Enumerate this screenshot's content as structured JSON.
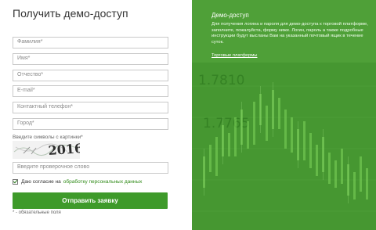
{
  "form": {
    "title": "Получить демо-доступ",
    "fields": [
      {
        "placeholder": "Фамилия*"
      },
      {
        "placeholder": "Имя*"
      },
      {
        "placeholder": "Отчество*"
      },
      {
        "placeholder": "E-mail*"
      },
      {
        "placeholder": "Контактный телефон*"
      },
      {
        "placeholder": "Город*"
      }
    ],
    "captcha_label": "Введите символы с картинки*",
    "captcha_text": "2016",
    "captcha_placeholder": "Введите проверочное слово",
    "agree_text": "Даю согласие на",
    "agree_link": "обработку персональных данных",
    "submit_label": "Отправить заявку",
    "required_note": "* - обязательные поля"
  },
  "info": {
    "title": "Демо-доступ",
    "text": "Для получения логина и пароля для демо-доступа к торговой платформе, заполните, пожалуйста, форму ниже. Логин, пароль а также подробные инструкции будут высланы Вам на указанный почтовый ящик в течение суток.",
    "link": "Торговые платформы",
    "chart_numbers": [
      "1.7810",
      "1.7765"
    ]
  },
  "colors": {
    "accent_green": "#3e9a2a",
    "panel_green": "#4fa038",
    "link_green": "#2f8a17"
  }
}
